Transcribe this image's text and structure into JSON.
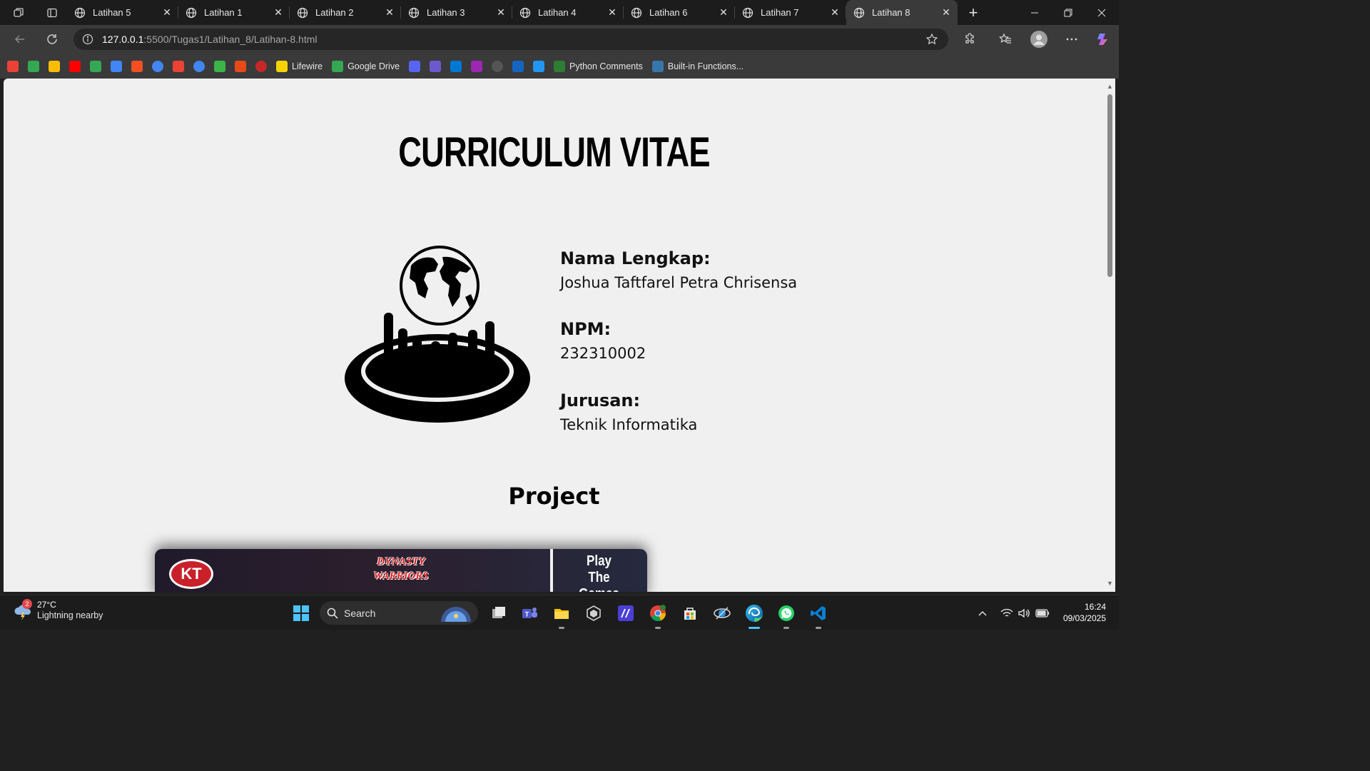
{
  "tabs": [
    {
      "title": "Latihan 5",
      "active": false
    },
    {
      "title": "Latihan 1",
      "active": false
    },
    {
      "title": "Latihan 2",
      "active": false
    },
    {
      "title": "Latihan 3",
      "active": false
    },
    {
      "title": "Latihan 4",
      "active": false
    },
    {
      "title": "Latihan 6",
      "active": false
    },
    {
      "title": "Latihan 7",
      "active": false
    },
    {
      "title": "Latihan 8",
      "active": true
    }
  ],
  "address": {
    "host": "127.0.0.1",
    "path": ":5500/Tugas1/Latihan_8/Latihan-8.html"
  },
  "bookmarks": [
    {
      "icon": "gmail-icon",
      "label": "",
      "color": "#ea4335"
    },
    {
      "icon": "google-drive-icon",
      "label": "",
      "color": "#34a853"
    },
    {
      "icon": "google-photos-icon",
      "label": "",
      "color": "#fbbc04"
    },
    {
      "icon": "youtube-icon",
      "label": "",
      "color": "#ff0000"
    },
    {
      "icon": "google-maps-icon",
      "label": "",
      "color": "#34a853"
    },
    {
      "icon": "google-translate-icon",
      "label": "",
      "color": "#4285f4"
    },
    {
      "icon": "microsoft-icon",
      "label": "",
      "color": "#f25022"
    },
    {
      "icon": "google-icon",
      "label": "",
      "color": "#4285f4"
    },
    {
      "icon": "gmail-icon",
      "label": "",
      "color": "#ea4335"
    },
    {
      "icon": "google-icon",
      "label": "",
      "color": "#4285f4"
    },
    {
      "icon": "leaf-icon",
      "label": "",
      "color": "#3bb54a"
    },
    {
      "icon": "colorful-grid-icon",
      "label": "",
      "color": "#e64a19"
    },
    {
      "icon": "avatar-icon",
      "label": "",
      "color": "#c62828"
    },
    {
      "icon": "lifewire-icon",
      "label": "Lifewire",
      "color": "#f5d300"
    },
    {
      "icon": "google-drive-icon",
      "label": "Google Drive",
      "color": "#34a853"
    },
    {
      "icon": "discord-icon",
      "label": "",
      "color": "#5865f2"
    },
    {
      "icon": "play-icon",
      "label": "",
      "color": "#6a5acd"
    },
    {
      "icon": "onedrive-icon",
      "label": "",
      "color": "#0078d4"
    },
    {
      "icon": "z-icon",
      "label": "",
      "color": "#9c27b0"
    },
    {
      "icon": "vs-icon",
      "label": "",
      "color": "#555555"
    },
    {
      "icon": "wave-icon",
      "label": "",
      "color": "#1565c0"
    },
    {
      "icon": "diamond-icon",
      "label": "",
      "color": "#2196f3"
    },
    {
      "icon": "w-icon",
      "label": "Python Comments",
      "color": "#2e7d32"
    },
    {
      "icon": "python-icon",
      "label": "Built-in Functions...",
      "color": "#3776ab"
    }
  ],
  "page": {
    "title": "CURRICULUM VITAE",
    "fields": [
      {
        "label": "Nama Lengkap:",
        "value": "Joshua Taftfarel Petra Chrisensa"
      },
      {
        "label": "NPM:",
        "value": "232310002"
      },
      {
        "label": "Jurusan:",
        "value": "Teknik Informatika"
      }
    ],
    "project_heading": "Project",
    "banner": {
      "logo": "KT",
      "game_line1": "DYNASTY",
      "game_line2": "WARRIORS",
      "play_line1": "Play",
      "play_line2": "The Games"
    }
  },
  "taskbar": {
    "weather_temp": "27°C",
    "weather_desc": "Lightning nearby",
    "weather_badge": "2",
    "search_label": "Search",
    "time": "16:24",
    "date": "09/03/2025"
  }
}
